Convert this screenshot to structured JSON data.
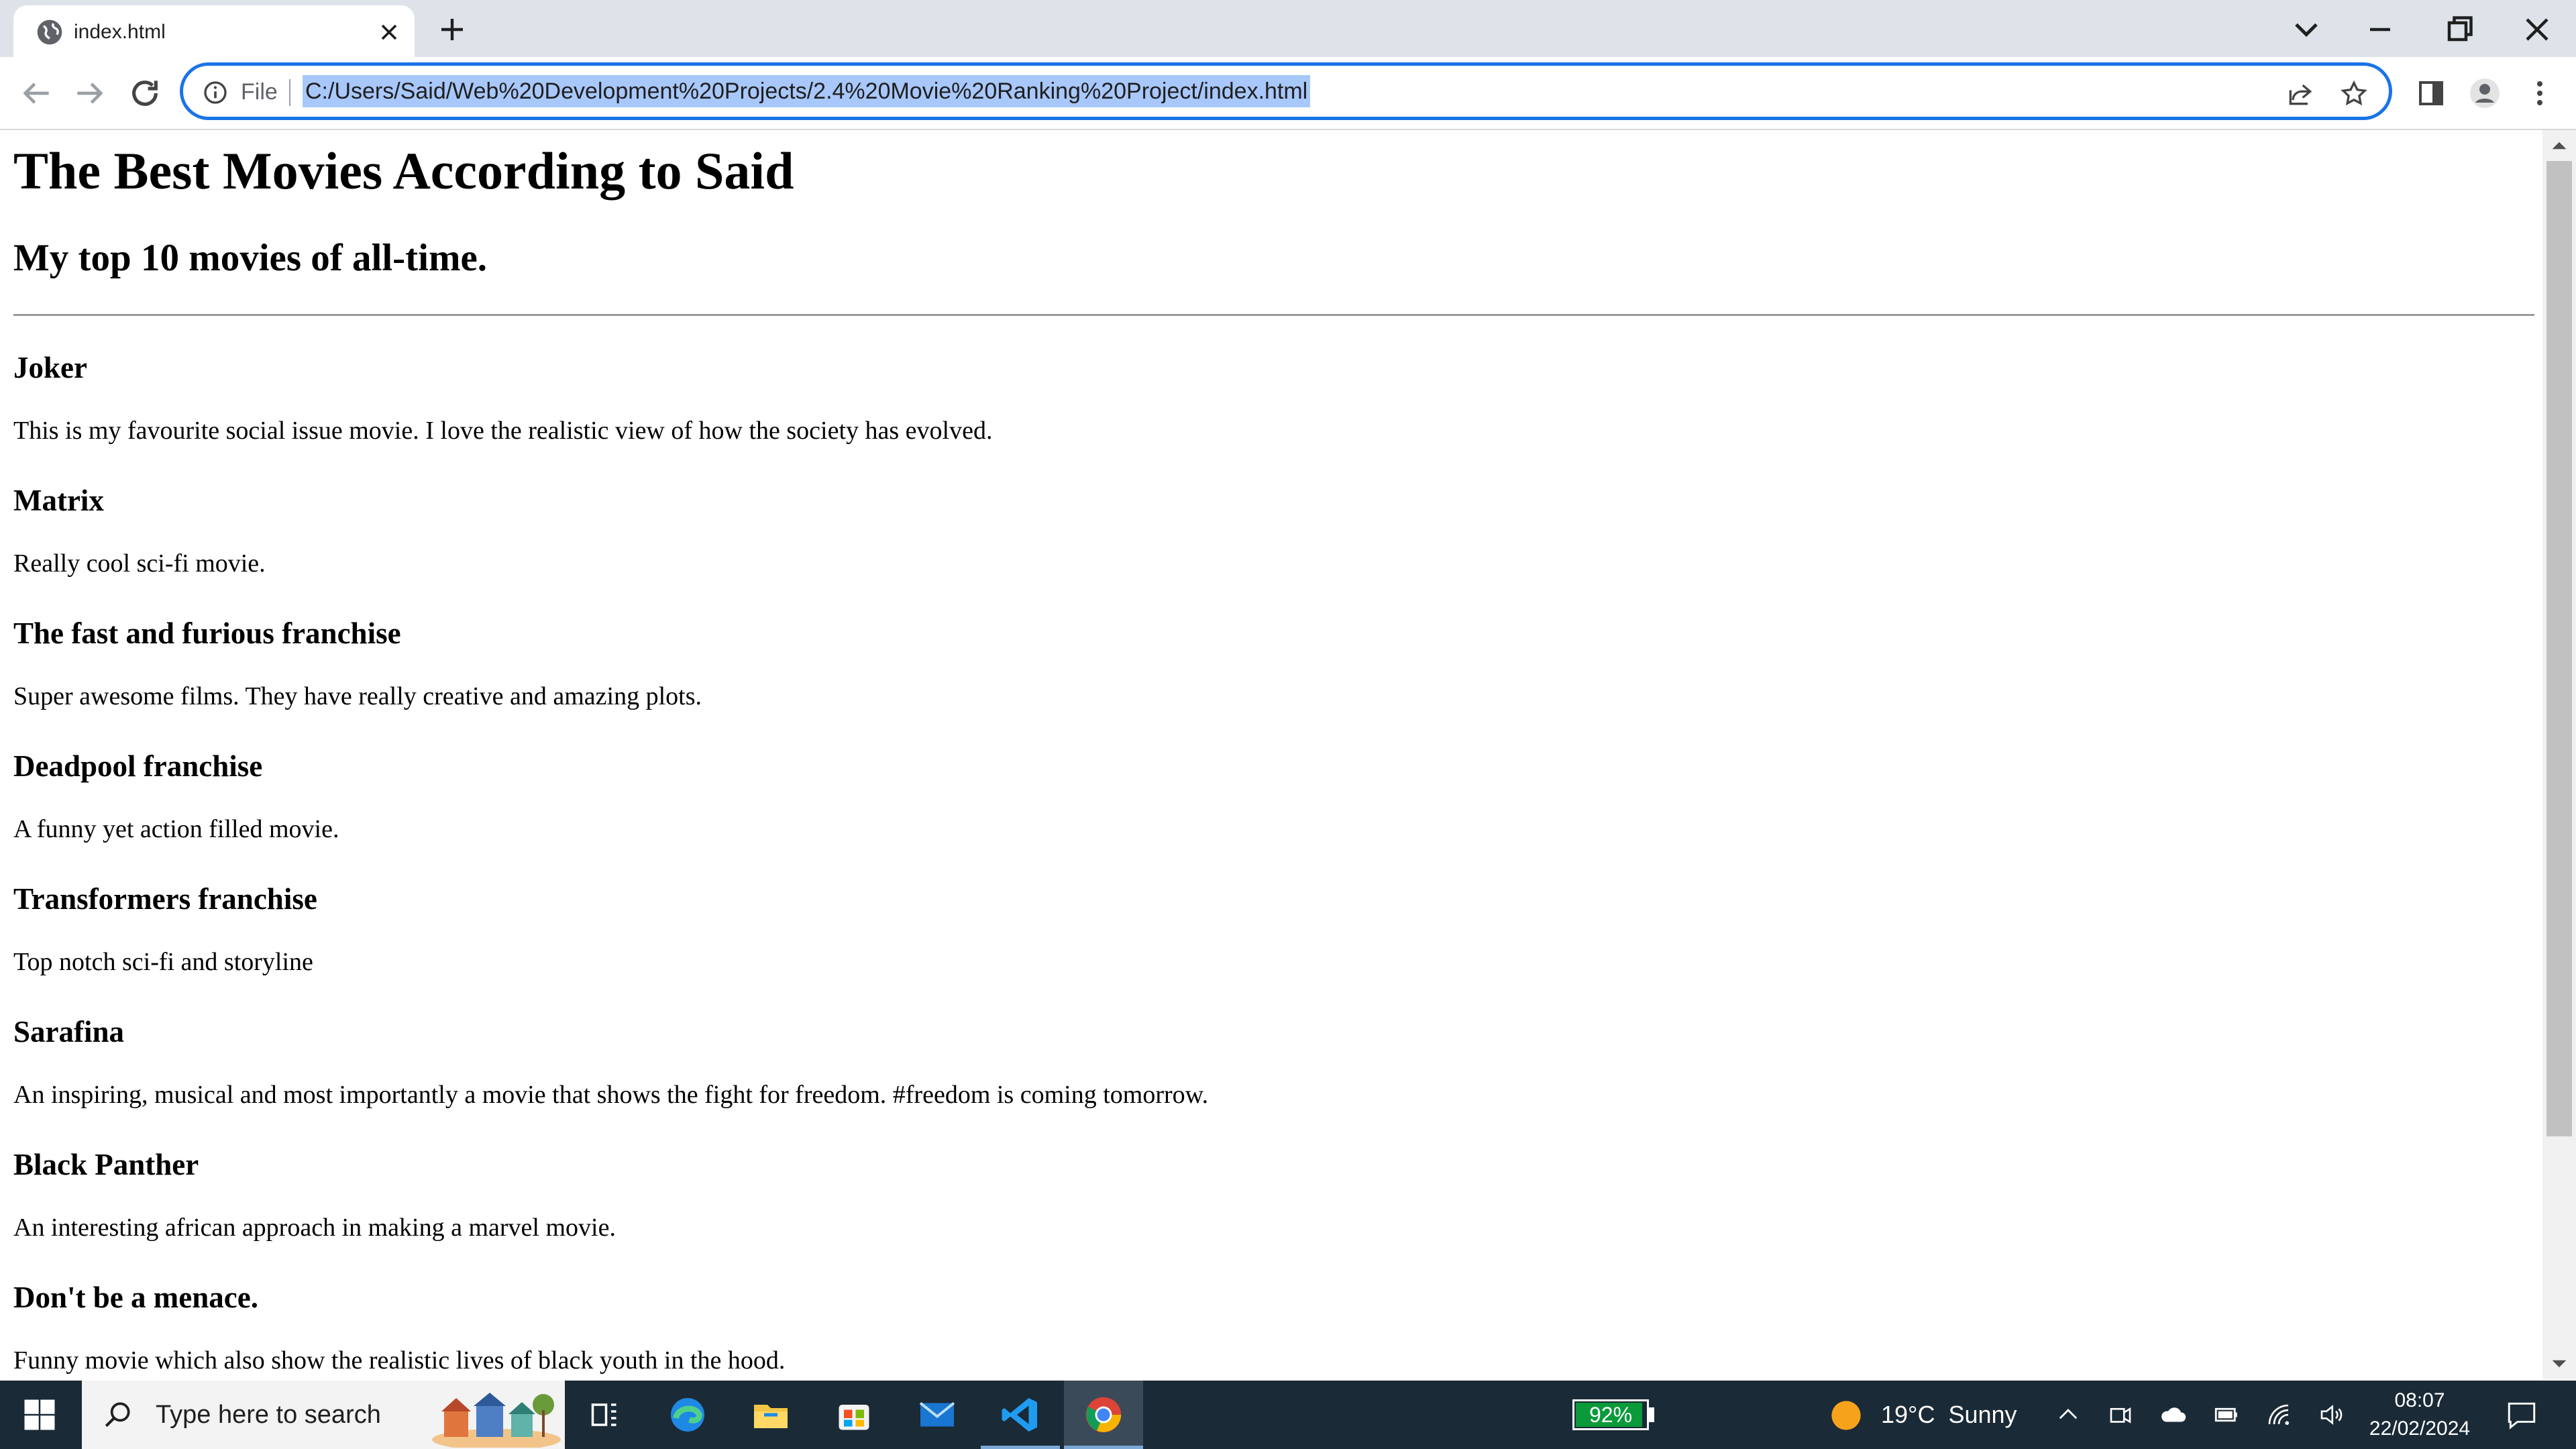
{
  "browser": {
    "tab": {
      "title": "index.html",
      "icon": "globe-icon"
    },
    "address": {
      "scheme_label": "File",
      "url": "C:/Users/Said/Web%20Development%20Projects/2.4%20Movie%20Ranking%20Project/index.html"
    },
    "colors": {
      "accent": "#1a73e8",
      "selection": "#a8c7fa",
      "tabstrip": "#dee3ea"
    }
  },
  "page": {
    "title": "The Best Movies According to Said",
    "subtitle": "My top 10 movies of all-time.",
    "movies": [
      {
        "name": "Joker",
        "description": "This is my favourite social issue movie. I love the realistic view of how the society has evolved."
      },
      {
        "name": "Matrix",
        "description": "Really cool sci-fi movie."
      },
      {
        "name": "The fast and furious franchise",
        "description": "Super awesome films. They have really creative and amazing plots."
      },
      {
        "name": "Deadpool franchise",
        "description": "A funny yet action filled movie."
      },
      {
        "name": "Transformers franchise",
        "description": "Top notch sci-fi and storyline"
      },
      {
        "name": "Sarafina",
        "description": "An inspiring, musical and most importantly a movie that shows the fight for freedom. #freedom is coming tomorrow."
      },
      {
        "name": "Black Panther",
        "description": "An interesting african approach in making a marvel movie."
      },
      {
        "name": "Don't be a menace.",
        "description": "Funny movie which also show the realistic lives of black youth in the hood."
      }
    ]
  },
  "taskbar": {
    "search_placeholder": "Type here to search",
    "battery": "92%",
    "weather": "19°C  Sunny",
    "time": "08:07",
    "date": "22/02/2024"
  }
}
